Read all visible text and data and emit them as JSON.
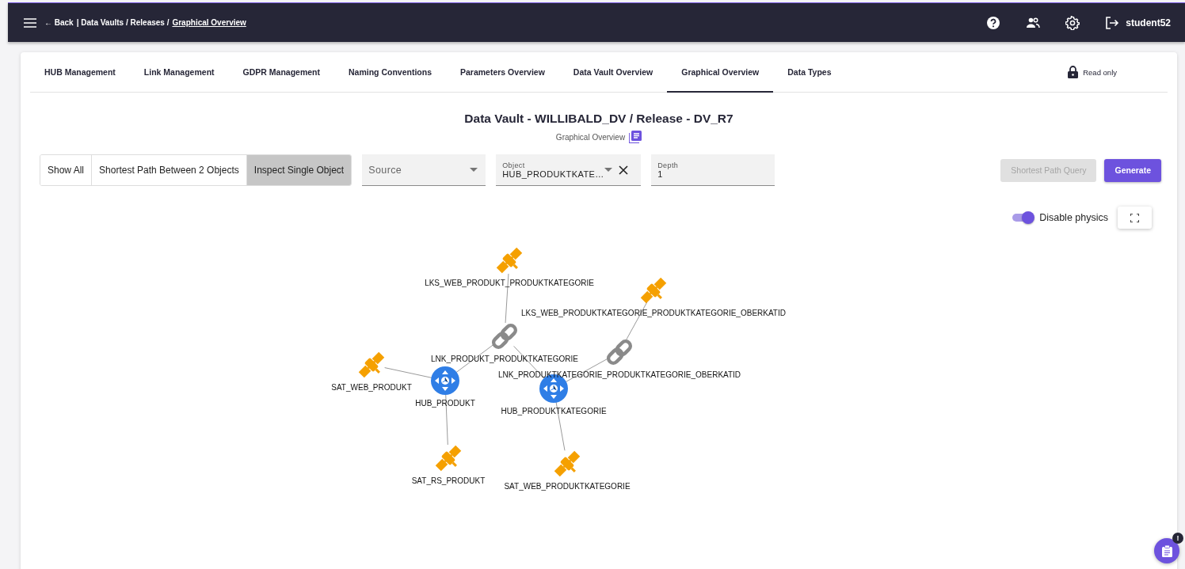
{
  "header": {
    "back": "← Back",
    "trail": "| Data Vaults / Releases /",
    "current": "Graphical Overview",
    "user": "student52"
  },
  "tabs": [
    {
      "label": "HUB Management",
      "selected": false
    },
    {
      "label": "Link Management",
      "selected": false
    },
    {
      "label": "GDPR Management",
      "selected": false
    },
    {
      "label": "Naming Conventions",
      "selected": false
    },
    {
      "label": "Parameters Overview",
      "selected": false
    },
    {
      "label": "Data Vault Overview",
      "selected": false
    },
    {
      "label": "Graphical Overview",
      "selected": true
    },
    {
      "label": "Data Types",
      "selected": false
    }
  ],
  "read_only": "Read only",
  "title": "Data Vault - WILLIBALD_DV / Release - DV_R7",
  "subtitle": "Graphical Overview",
  "modes": [
    {
      "label": "Show All",
      "selected": false
    },
    {
      "label": "Shortest Path Between 2 Objects",
      "selected": false
    },
    {
      "label": "Inspect Single Object",
      "selected": true
    }
  ],
  "source_select": {
    "placeholder": "Source"
  },
  "object_select": {
    "label": "Object",
    "value": "HUB_PRODUKTKATE…"
  },
  "depth_field": {
    "label": "Depth",
    "value": "1"
  },
  "buttons": [
    {
      "label": "Shortest Path Query",
      "disabled": true
    },
    {
      "label": "Generate",
      "disabled": false
    }
  ],
  "physics_toggle": {
    "label": "Disable physics",
    "on": true
  },
  "graph": {
    "nodes": [
      {
        "kind": "satellite",
        "label": "LKS_WEB_PRODUKT_PRODUKTKATEGORIE"
      },
      {
        "kind": "satellite",
        "label": "LKS_WEB_PRODUKTKATEGORIE_PRODUKTKATEGORIE_OBERKATID"
      },
      {
        "kind": "link",
        "label": "LNK_PRODUKT_PRODUKTKATEGORIE"
      },
      {
        "kind": "link",
        "label": "LNK_PRODUKTKATEGORIE_PRODUKTKATEGORIE_OBERKATID"
      },
      {
        "kind": "satellite",
        "label": "SAT_WEB_PRODUKT"
      },
      {
        "kind": "hub",
        "label": "HUB_PRODUKT"
      },
      {
        "kind": "hub",
        "label": "HUB_PRODUKTKATEGORIE"
      },
      {
        "kind": "satellite",
        "label": "SAT_RS_PRODUKT"
      },
      {
        "kind": "satellite",
        "label": "SAT_WEB_PRODUKTKATEGORIE"
      }
    ]
  },
  "notes_badge": "!"
}
